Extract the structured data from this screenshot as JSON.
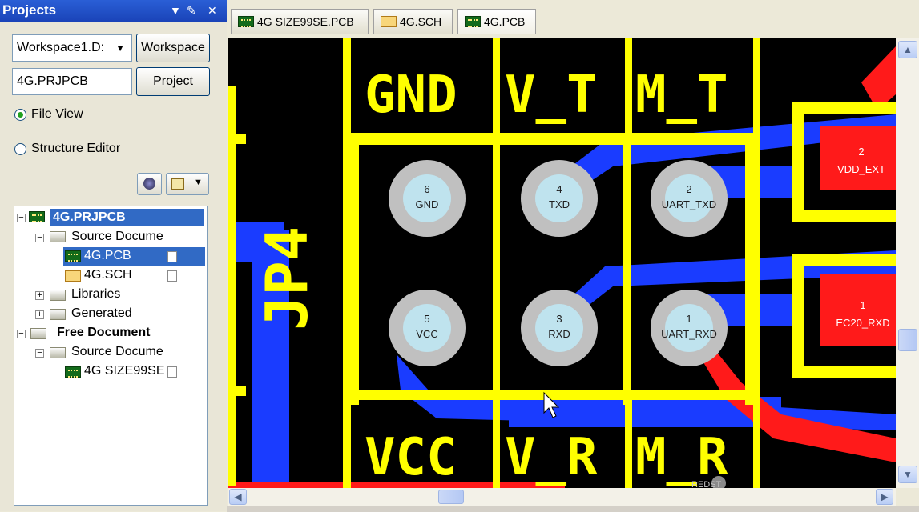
{
  "panel": {
    "title": "Projects",
    "header_icons": [
      "dropdown-arrow-icon",
      "pin-icon",
      "close-icon"
    ],
    "workspace_combo": "Workspace1.D:",
    "workspace_button": "Workspace",
    "project_field": "4G.PRJPCB",
    "project_button": "Project",
    "radio_file_view": "File View",
    "radio_structure_editor": "Structure Editor",
    "selected_view": "File View"
  },
  "tree": {
    "items": [
      {
        "label": "4G.PRJPCB",
        "level": 0,
        "expanded": true,
        "icon": "pcb-project-icon",
        "selected": true,
        "bold": true
      },
      {
        "label": "Source Docume",
        "level": 1,
        "expanded": true,
        "icon": "folder-icon"
      },
      {
        "label": "4G.PCB",
        "level": 2,
        "icon": "pcb-document-icon",
        "selected": true
      },
      {
        "label": "4G.SCH",
        "level": 2,
        "icon": "schematic-document-icon"
      },
      {
        "label": "Libraries",
        "level": 1,
        "expanded": false,
        "icon": "folder-icon"
      },
      {
        "label": "Generated",
        "level": 1,
        "expanded": false,
        "icon": "folder-icon"
      },
      {
        "label": "Free Document",
        "level": 0,
        "expanded": true,
        "bold": true,
        "icon": "folder-icon"
      },
      {
        "label": "Source Docume",
        "level": 1,
        "expanded": true,
        "icon": "folder-icon"
      },
      {
        "label": "4G SIZE99SE",
        "level": 2,
        "icon": "pcb-document-icon"
      }
    ]
  },
  "tabs": [
    {
      "label": "4G SIZE99SE.PCB",
      "icon": "pcb-document-icon"
    },
    {
      "label": "4G.SCH",
      "icon": "schematic-document-icon"
    },
    {
      "label": "4G.PCB",
      "icon": "pcb-document-icon",
      "active": true
    }
  ],
  "pcb": {
    "designator": "JP4",
    "top_labels": [
      "GND",
      "V_T",
      "M_T"
    ],
    "bottom_labels": [
      "VCC",
      "V_R",
      "M_R"
    ],
    "pins": [
      {
        "number": "6",
        "name": "GND"
      },
      {
        "number": "4",
        "name": "TXD"
      },
      {
        "number": "2",
        "name": "UART_TXD"
      },
      {
        "number": "5",
        "name": "VCC"
      },
      {
        "number": "3",
        "name": "RXD"
      },
      {
        "number": "1",
        "name": "UART_RXD"
      }
    ],
    "pads": [
      {
        "number": "2",
        "name": "VDD_EXT"
      },
      {
        "number": "1",
        "name": "EC20_RXD"
      }
    ],
    "partial_text": "REDST",
    "colors": {
      "silkscreen": "#ffff00",
      "top_layer": "#ff1a1a",
      "bottom_layer": "#1a3cff",
      "pad": "#c0c0c0",
      "hole": "#bfe3ee",
      "background": "#000000"
    }
  }
}
